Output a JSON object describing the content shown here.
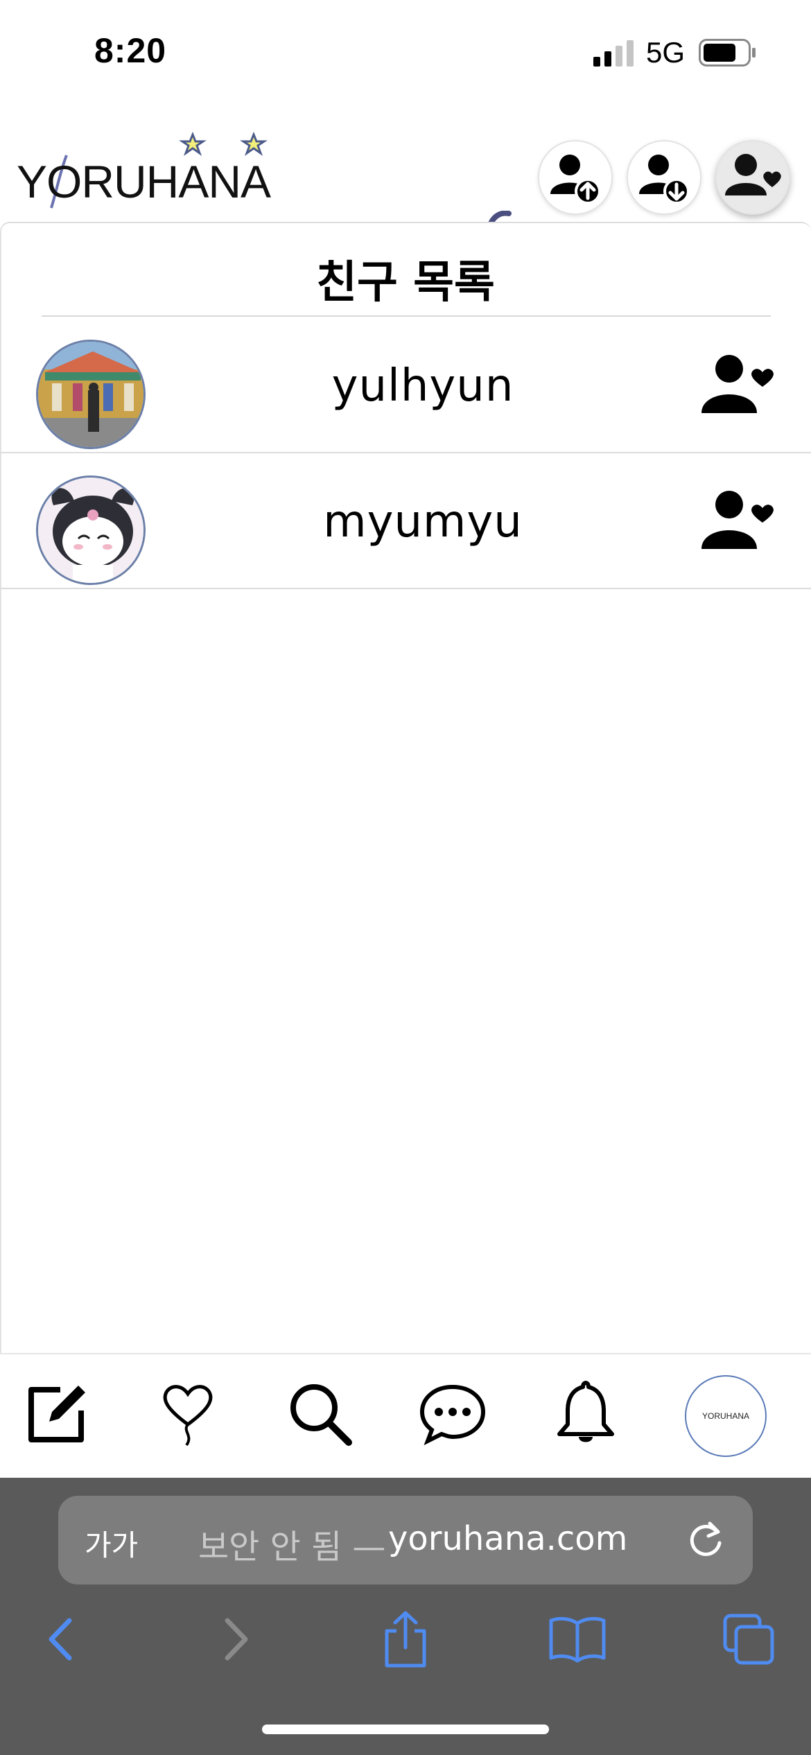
{
  "status_bar": {
    "time": "8:20",
    "network": "5G",
    "icons": [
      "signal-icon",
      "battery-icon"
    ]
  },
  "header": {
    "logo_text": "YORUHANA",
    "buttons": [
      {
        "icon": "user-upload-icon"
      },
      {
        "icon": "user-download-icon"
      },
      {
        "icon": "user-heart-icon",
        "active": true
      }
    ]
  },
  "panel": {
    "title": "친구 목록",
    "friends": [
      {
        "name": "yulhyun",
        "avatar": "carousel-photo",
        "action_icon": "user-heart-icon"
      },
      {
        "name": "myumyu",
        "avatar": "cartoon-character",
        "action_icon": "user-heart-icon"
      }
    ]
  },
  "bottom_nav": {
    "items": [
      "edit-icon",
      "heart-balloon-icon",
      "search-icon",
      "chat-bubble-icon",
      "bell-icon"
    ],
    "profile_avatar_text": "YORUHANA"
  },
  "browser": {
    "aa_label": "가가",
    "security_text": "보안 안 됨 —",
    "domain": "yoruhana.com",
    "toolbar": [
      "back-icon",
      "forward-icon",
      "share-icon",
      "bookmarks-icon",
      "tabs-icon"
    ]
  },
  "colors": {
    "browser_bg": "#5a5a5a",
    "address_bg": "#7d7d7d",
    "toolbar_blue": "#4f8bf0",
    "avatar_border": "#6b7fa8"
  }
}
